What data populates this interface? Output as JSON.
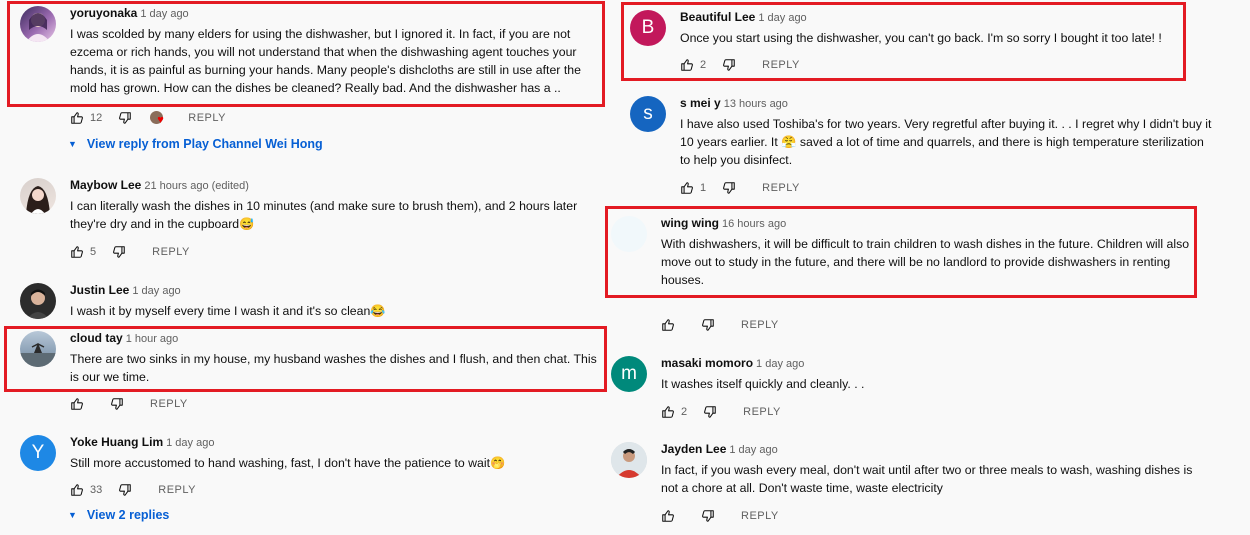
{
  "left": [
    {
      "author": "yoruyonaka",
      "time": "1 day ago",
      "text": "I was scolded by many elders for using the dishwasher, but I ignored it. In fact, if you are not ezcema or rich hands, you will not understand that when the dishwashing agent touches your hands, it is as painful as burning your hands. Many people's dishcloths are still in use after the mold has grown. How can the dishes be cleaned? Really bad. And the dishwasher has a ..",
      "likes": "12",
      "reply": "REPLY"
    },
    {
      "view_replies": "View reply from Play Channel Wei Hong"
    },
    {
      "author": "Maybow Lee",
      "time": "21 hours ago (edited)",
      "text": "I can literally wash the dishes in 10 minutes (and make sure to brush them), and 2 hours later they're dry and in the cupboard😅",
      "likes": "5",
      "reply": "REPLY"
    },
    {
      "author": "Justin Lee",
      "time": "1 day ago",
      "text": "I wash it by myself every time I wash it and it's so clean😂"
    },
    {
      "author": "cloud tay",
      "time": "1 hour ago",
      "text": "There are two sinks in my house, my husband washes the dishes and I flush, and then chat. This is our we time.",
      "likes": "",
      "reply": "REPLY"
    },
    {
      "author": "Yoke Huang Lim",
      "time": "1 day ago",
      "text": "Still more accustomed to hand washing, fast, I don't have the patience to wait🤭",
      "likes": "33",
      "reply": "REPLY",
      "avatar_letter": "Y"
    },
    {
      "view_replies": "View 2 replies"
    }
  ],
  "right": [
    {
      "author": "Beautiful Lee",
      "time": "1 day ago",
      "text": "Once you start using the dishwasher, you can't go back. I'm so sorry I bought it too late! !",
      "likes": "2",
      "reply": "REPLY",
      "avatar_letter": "B"
    },
    {
      "author": "s mei y",
      "time": "13 hours ago",
      "text": "I have also used Toshiba's for two years. Very regretful after buying it. . . I regret why I didn't buy it 10 years earlier. It 😤 saved a lot of time and quarrels, and there is high temperature sterilization to help you disinfect.",
      "likes": "1",
      "reply": "REPLY",
      "avatar_letter": "S"
    },
    {
      "author": "wing wing",
      "time": "16 hours ago",
      "text": "With dishwashers, it will be difficult to train children to wash dishes in the future. Children will also move out to study in the future, and there will be no landlord to provide dishwashers in renting houses.",
      "likes": "",
      "reply": "REPLY"
    },
    {
      "author": "masaki momoro",
      "time": "1 day ago",
      "text": "It washes itself quickly and cleanly. . .",
      "likes": "2",
      "reply": "REPLY",
      "avatar_letter": "m"
    },
    {
      "author": "Jayden Lee",
      "time": "1 day ago",
      "text": "In fact, if you wash every meal, don't wait until after two or three meals to wash, washing dishes is not a chore at all. Don't waste time, waste electricity",
      "likes": "",
      "reply": "REPLY"
    }
  ],
  "colors": {
    "highlight": "#e31b23",
    "link": "#065fd4",
    "avatar_b": "#c2185b",
    "avatar_s": "#1565c0",
    "avatar_m": "#00897b",
    "avatar_y": "#1e88e5"
  }
}
